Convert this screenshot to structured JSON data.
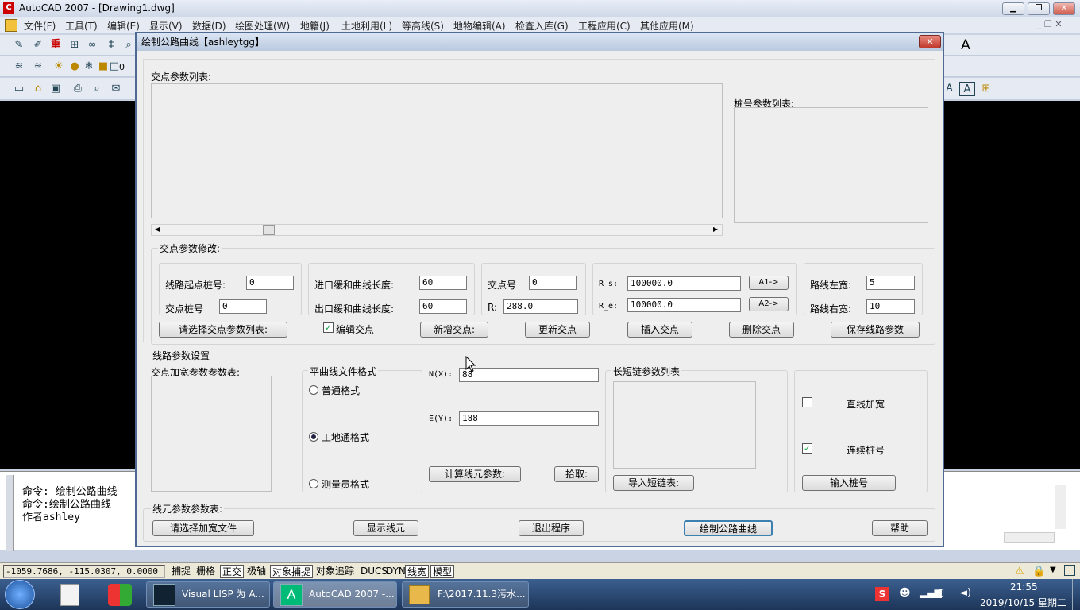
{
  "app": {
    "title": "AutoCAD 2007 - [Drawing1.dwg]"
  },
  "menu": [
    "文件(F)",
    "工具(T)",
    "编辑(E)",
    "显示(V)",
    "数据(D)",
    "绘图处理(W)",
    "地籍(J)",
    "土地利用(L)",
    "等高线(S)",
    "地物编辑(A)",
    "检查入库(G)",
    "工程应用(C)",
    "其他应用(M)"
  ],
  "toolbar": {
    "red_label": "重",
    "layer_value": "0"
  },
  "command": {
    "lines": [
      "命令: 绘制公路曲线",
      "命令:绘制公路曲线",
      "作者ashley"
    ]
  },
  "status": {
    "coords": "-1059.7686, -115.0307, 0.0000",
    "buttons": [
      {
        "label": "捕捉",
        "on": false
      },
      {
        "label": "栅格",
        "on": false
      },
      {
        "label": "正交",
        "on": true
      },
      {
        "label": "极轴",
        "on": false
      },
      {
        "label": "对象捕捉",
        "on": true
      },
      {
        "label": "对象追踪",
        "on": false
      },
      {
        "label": "DUCS",
        "on": false
      },
      {
        "label": "DYN",
        "on": false
      },
      {
        "label": "线宽",
        "on": true
      },
      {
        "label": "模型",
        "on": true
      }
    ]
  },
  "taskbar": {
    "items": [
      "Visual LISP 为 A...",
      "AutoCAD 2007 -...",
      "F:\\2017.11.3污水..."
    ],
    "time": "21:55",
    "date": "2019/10/15 星期二"
  },
  "dialog": {
    "title": "绘制公路曲线【ashleytgg】",
    "jd_list_label": "交点参数列表:",
    "zh_list_label": "桩号参数列表:",
    "modify_label": "交点参数修改:",
    "start_station_label": "线路起点桩号:",
    "start_station": "0",
    "jd_station_label": "交点桩号",
    "jd_station": "0",
    "in_len_label": "进口缓和曲线长度:",
    "in_len": "60",
    "out_len_label": "出口缓和曲线长度:",
    "out_len": "60",
    "jd_no_label": "交点号",
    "jd_no": "0",
    "r_label": "R:",
    "r": "288.0",
    "rs_label": "R_s:",
    "rs": "100000.0",
    "re_label": "R_e:",
    "re": "100000.0",
    "a1": "A1->",
    "a2": "A2->",
    "left_w_label": "路线左宽:",
    "left_w": "5",
    "right_w_label": "路线右宽:",
    "right_w": "10",
    "btn_select_list": "请选择交点参数列表:",
    "edit_jd_label": "编辑交点",
    "edit_jd_checked": true,
    "btn_new": "新增交点:",
    "btn_update": "更新交点",
    "btn_insert": "插入交点",
    "btn_delete": "删除交点",
    "btn_save": "保存线路参数",
    "route_settings": "线路参数设置",
    "widen_list_label": "交点加宽参数参数表:",
    "format_label": "平曲线文件格式",
    "formats": [
      "普通格式",
      "工地通格式",
      "测量员格式"
    ],
    "format_selected": 1,
    "n_label": "N(X):",
    "n": "88",
    "e_label": "E(Y):",
    "e": "188",
    "btn_calc": "计算线元参数:",
    "btn_pick": "拾取:",
    "chain_label": "长短链参数列表",
    "btn_import_chain": "导入短链表:",
    "straight_widen": "直线加宽",
    "straight_widen_checked": false,
    "continuous": "连续桩号",
    "continuous_checked": true,
    "btn_input_station": "输入桩号",
    "elem_list_label": "线元参数参数表:",
    "btn_widen_file": "请选择加宽文件",
    "btn_show_elem": "显示线元",
    "btn_exit": "退出程序",
    "btn_draw": "绘制公路曲线",
    "btn_help": "帮助"
  }
}
